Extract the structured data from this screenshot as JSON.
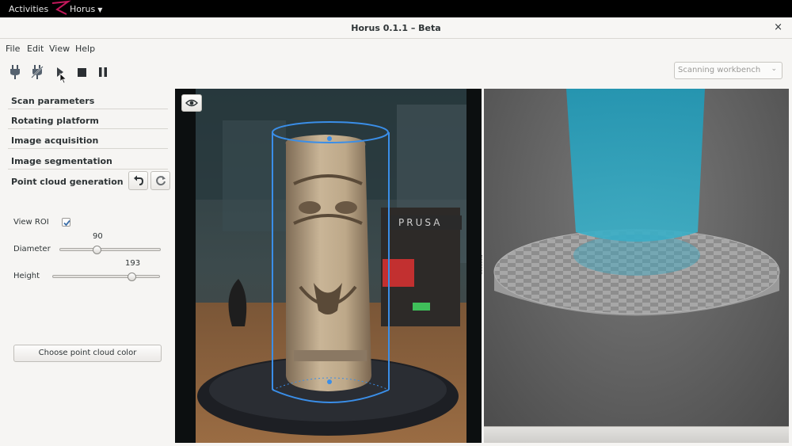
{
  "topbar": {
    "activities": "Activities",
    "app_menu": "Horus"
  },
  "window": {
    "title": "Horus 0.1.1 – Beta",
    "close": "×"
  },
  "menu": [
    "File",
    "Edit",
    "View",
    "Help"
  ],
  "toolbar": {
    "icons": [
      "connect-icon",
      "disconnect-icon",
      "play-icon",
      "stop-icon",
      "pause-icon"
    ],
    "workbench": "Scanning workbench"
  },
  "sections": [
    "Scan parameters",
    "Rotating platform",
    "Image acquisition",
    "Image segmentation",
    "Point cloud generation"
  ],
  "point_cloud": {
    "view_roi_label": "View ROI",
    "view_roi_checked": true,
    "diameter_label": "Diameter",
    "diameter_value": "90",
    "height_label": "Height",
    "height_value": "193",
    "color_button": "Choose point cloud color"
  },
  "video": {
    "printer_text": "PRUSA"
  },
  "colors": {
    "roi_outline": "#3a8ee8",
    "scan_beam": "#2ba3c2",
    "logo_dots": [
      "#c2185b",
      "#c2185b",
      "#c2185b",
      "#ef6c00",
      "#7b1fa2"
    ]
  }
}
